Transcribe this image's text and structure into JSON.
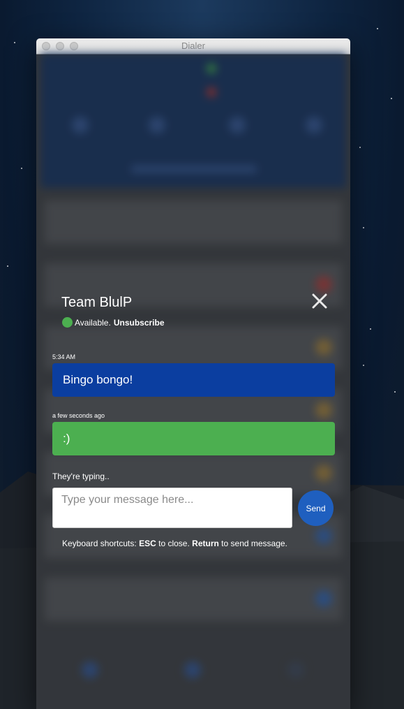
{
  "window": {
    "title": "Dialer"
  },
  "chat": {
    "title": "Team BlulP",
    "status_text": "Available.",
    "unsubscribe_label": "Unsubscribe",
    "close_icon": "close-icon",
    "messages": [
      {
        "timestamp": "5:34 AM",
        "text": "Bingo bongo!",
        "color": "#0b3ea0"
      },
      {
        "timestamp": "a few seconds ago",
        "text": ":)",
        "color": "#4caf50"
      }
    ],
    "typing_indicator": "They're typing..",
    "input_placeholder": "Type your message here...",
    "send_label": "Send",
    "shortcuts": {
      "prefix": "Keyboard shortcuts:",
      "key1": "ESC",
      "action1": "to close.",
      "key2": "Return",
      "action2": "to send message."
    }
  },
  "colors": {
    "available": "#4caf50",
    "send_button": "#1f5fbf"
  }
}
